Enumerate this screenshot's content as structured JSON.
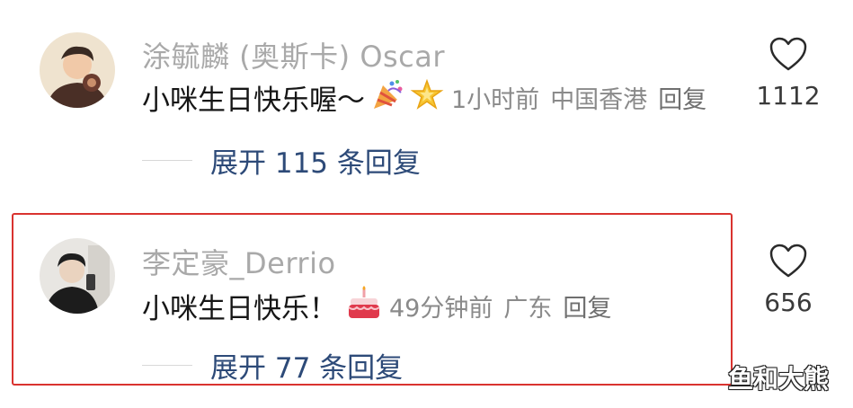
{
  "comments": [
    {
      "username": "涂毓麟 (奥斯卡) Oscar",
      "text": "小咪生日快乐喔～",
      "emoji_icons": [
        "party-popper-icon",
        "glowing-star-icon"
      ],
      "time": "1小时前",
      "location": "中国香港",
      "reply_label": "回复",
      "like_count": "1112",
      "expand_label": "展开 115 条回复"
    },
    {
      "username": "李定豪_Derrio",
      "text": "小咪生日快乐！",
      "emoji_icons": [
        "birthday-cake-icon"
      ],
      "time": "49分钟前",
      "location": "广东",
      "reply_label": "回复",
      "like_count": "656",
      "expand_label": "展开 77 条回复"
    }
  ],
  "watermark": "鱼和大熊",
  "colors": {
    "highlight_border": "#d9332f",
    "expand_link": "#2d4a78",
    "username": "#a9a9a9"
  }
}
